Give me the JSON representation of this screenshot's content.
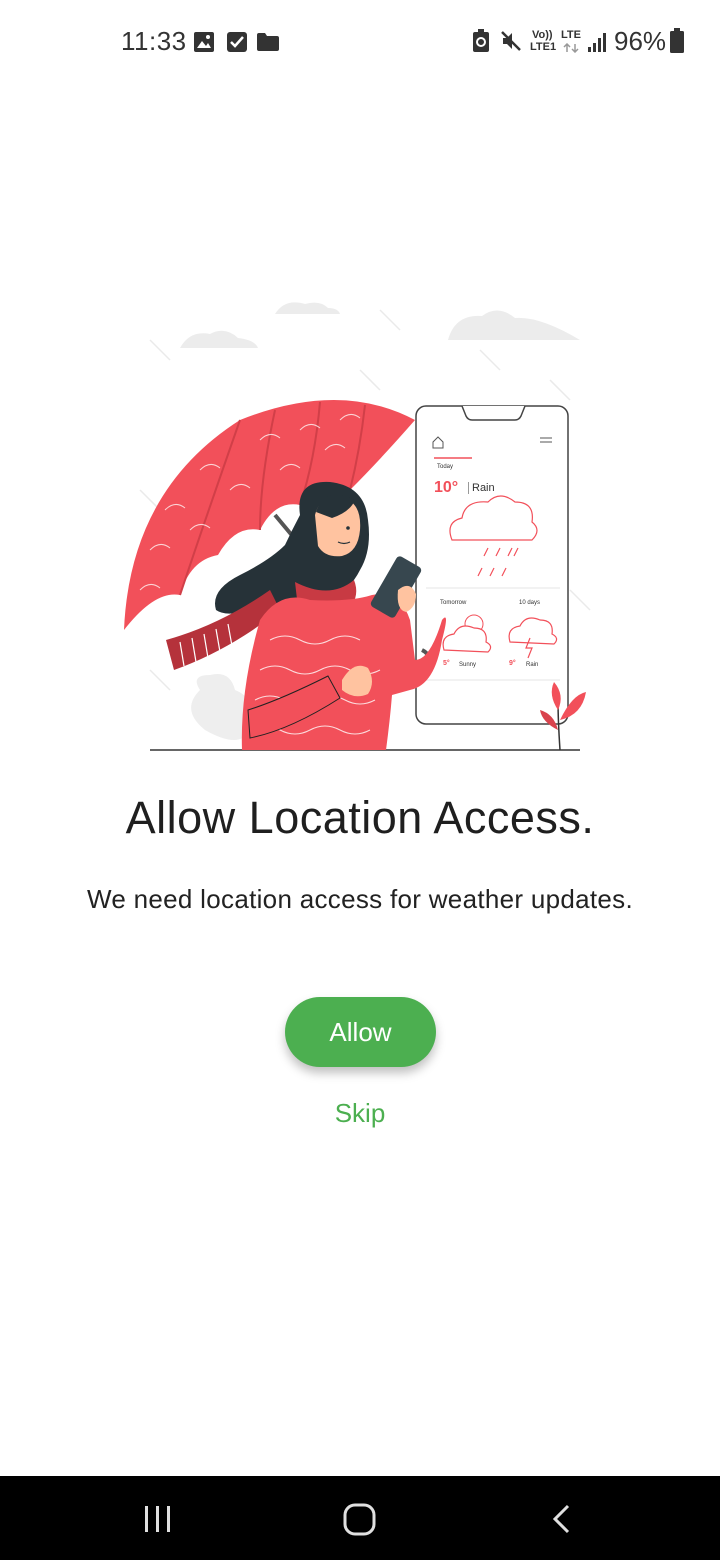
{
  "status_bar": {
    "time": "11:33",
    "battery": "96%",
    "signal_labels": {
      "volte": "Vo))",
      "lte1": "LTE1",
      "lte": "LTE"
    },
    "icons": [
      "gallery-icon",
      "checkbox-icon",
      "folder-icon",
      "battery-saver-icon",
      "mute-icon",
      "signal-icon",
      "battery-icon"
    ]
  },
  "illustration": {
    "card": {
      "today_label": "Today",
      "today_temp": "10°",
      "today_condition": "Rain",
      "tomorrow_label": "Tomorrow",
      "days_label": "10 days",
      "tomorrow_temp": "5°",
      "tomorrow_condition": "Sunny",
      "days_temp": "9°",
      "days_condition": "Rain"
    }
  },
  "content": {
    "title": "Allow Location Access.",
    "subtitle": "We need location access for weather updates.",
    "allow_label": "Allow",
    "skip_label": "Skip"
  },
  "nav_bar": {
    "buttons": [
      "recent-apps",
      "home",
      "back"
    ]
  },
  "colors": {
    "accent": "#4caf50",
    "illustration_red": "#f2505a",
    "nav_bg": "#000000"
  }
}
